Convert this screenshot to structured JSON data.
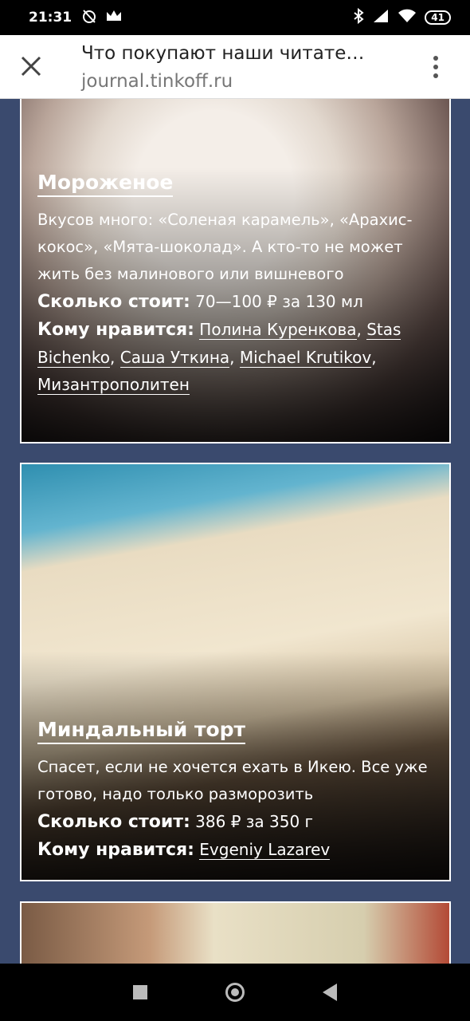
{
  "status_bar": {
    "time": "21:31",
    "battery": "41",
    "left_icons": [
      "no-alarm-icon",
      "crown-icon"
    ],
    "right_icons": [
      "bluetooth-icon",
      "signal-icon",
      "wifi-icon",
      "battery-icon"
    ]
  },
  "browser": {
    "page_title": "Что покупают наши читате…",
    "url": "journal.tinkoff.ru"
  },
  "cards": [
    {
      "title": "Мороженое",
      "description": "Вкусов много: «Соленая карамель», «Арахис-кокос», «Мята-шоколад». А кто-то не может жить без малинового или вишневого",
      "price_label": "Сколько стоит:",
      "price": "70—100 ₽ за 130 мл",
      "fans_label": "Кому нравится:",
      "fans": [
        "Полина Куренкова",
        "Stas Bichenko",
        "Саша Уткина",
        "Michael Krutikov",
        "Мизантрополитен"
      ]
    },
    {
      "title": "Миндальный торт",
      "description": "Спасет, если не хочется ехать в Икею. Все уже готово, надо только разморозить",
      "price_label": "Сколько стоит:",
      "price": "386 ₽ за 350 г",
      "fans_label": "Кому нравится:",
      "fans": [
        "Evgeniy Lazarev"
      ]
    }
  ],
  "colors": {
    "page_background": "#3a4a6e",
    "card_border": "#ffffff",
    "status_bar": "#000000"
  }
}
